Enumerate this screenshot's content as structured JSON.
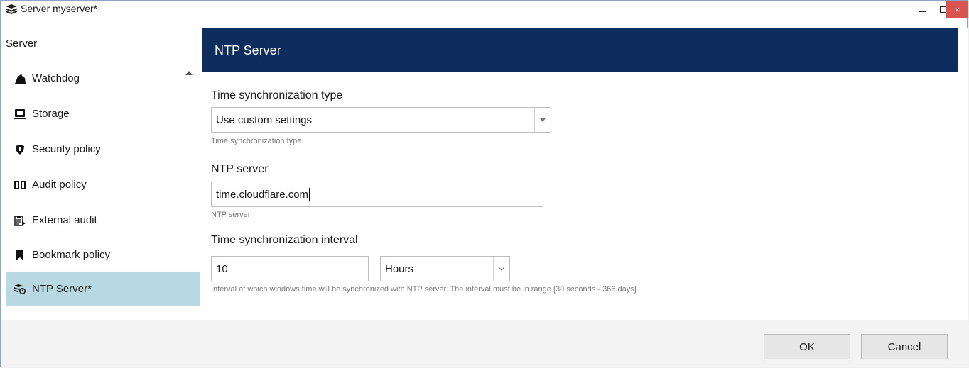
{
  "window": {
    "title": "Server myserver*",
    "icons": [
      "server-stack-icon",
      "minimize-icon",
      "maximize-icon",
      "close-icon"
    ],
    "close_glyph": "×"
  },
  "sidebar": {
    "header": "Server",
    "items": [
      {
        "label": "Watchdog",
        "icon": "dog-icon",
        "selected": false
      },
      {
        "label": "Storage",
        "icon": "storage-icon",
        "selected": false
      },
      {
        "label": "Security policy",
        "icon": "shield-icon",
        "selected": false
      },
      {
        "label": "Audit policy",
        "icon": "book-icon",
        "selected": false
      },
      {
        "label": "External audit",
        "icon": "clipboard-icon",
        "selected": false
      },
      {
        "label": "Bookmark policy",
        "icon": "bookmark-icon",
        "selected": false
      },
      {
        "label": "NTP Server*",
        "icon": "ntp-clock-icon",
        "selected": true
      }
    ]
  },
  "panel": {
    "title": "NTP Server",
    "sync_type": {
      "label": "Time synchronization type",
      "value": "Use custom settings",
      "hint": "Time synchronization type."
    },
    "ntp_server": {
      "label": "NTP server",
      "value": "time.cloudflare.com",
      "hint": "NTP server"
    },
    "interval": {
      "label": "Time synchronization interval",
      "value": "10",
      "unit": "Hours",
      "hint": "Interval at which windows time will be synchronized with NTP server. The interval must be in range [30 seconds - 366 days]."
    }
  },
  "footer": {
    "ok_label": "OK",
    "cancel_label": "Cancel"
  },
  "colors": {
    "header_bg": "#0d2d5e",
    "selected_bg": "#b9d9e2",
    "close_bg": "#d9534f"
  }
}
